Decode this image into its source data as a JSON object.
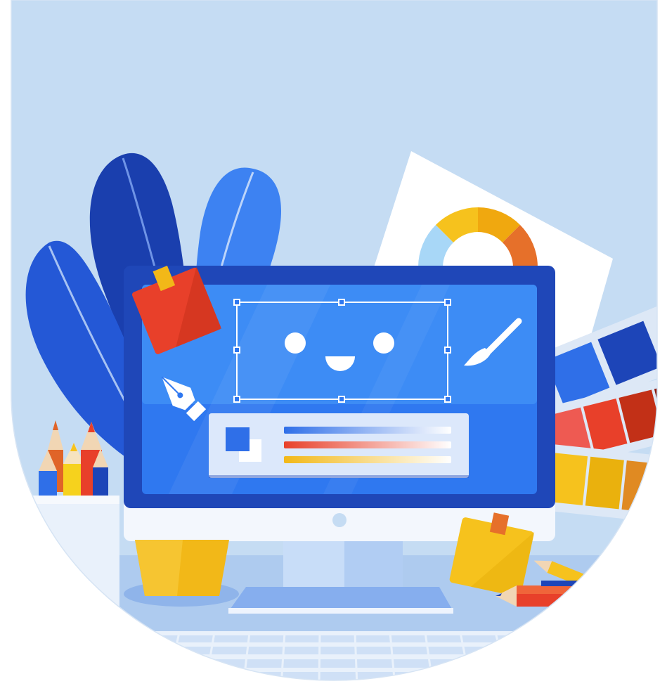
{
  "scene": {
    "subject": "design-workspace-illustration",
    "colors": {
      "background": "#c5dcf3",
      "desk": "#a9c8ee",
      "monitor_frame": "#1f47b8",
      "screen": "#2f78f0",
      "screen_light": "#3d8cf5",
      "plant_dark": "#1a3fae",
      "plant_mid": "#2a64de",
      "plant_light": "#3f86f4",
      "sticky_red": "#e8402a",
      "sticky_yellow": "#f6c21d",
      "pot_yellow": "#f2b818",
      "palette_gray": "#dde8f6"
    },
    "swatch_rows": [
      {
        "name": "blue",
        "colors": [
          "#2f6fe8",
          "#1d45b8"
        ]
      },
      {
        "name": "red",
        "colors": [
          "#ee5a52",
          "#e8402a",
          "#c23017",
          "#8a1b10"
        ]
      },
      {
        "name": "yellow",
        "colors": [
          "#f6c21d",
          "#eab10d",
          "#e08a22",
          "#d4691f"
        ]
      }
    ],
    "gradient_bars": [
      {
        "name": "blue",
        "color": "#2f6fe8"
      },
      {
        "name": "red",
        "color": "#e8402a"
      },
      {
        "name": "yellow",
        "color": "#f2b818"
      }
    ],
    "icons": [
      "pen-tool-icon",
      "paintbrush-icon",
      "smiley-face-icon",
      "color-wheel-icon",
      "pencil-icon"
    ]
  }
}
